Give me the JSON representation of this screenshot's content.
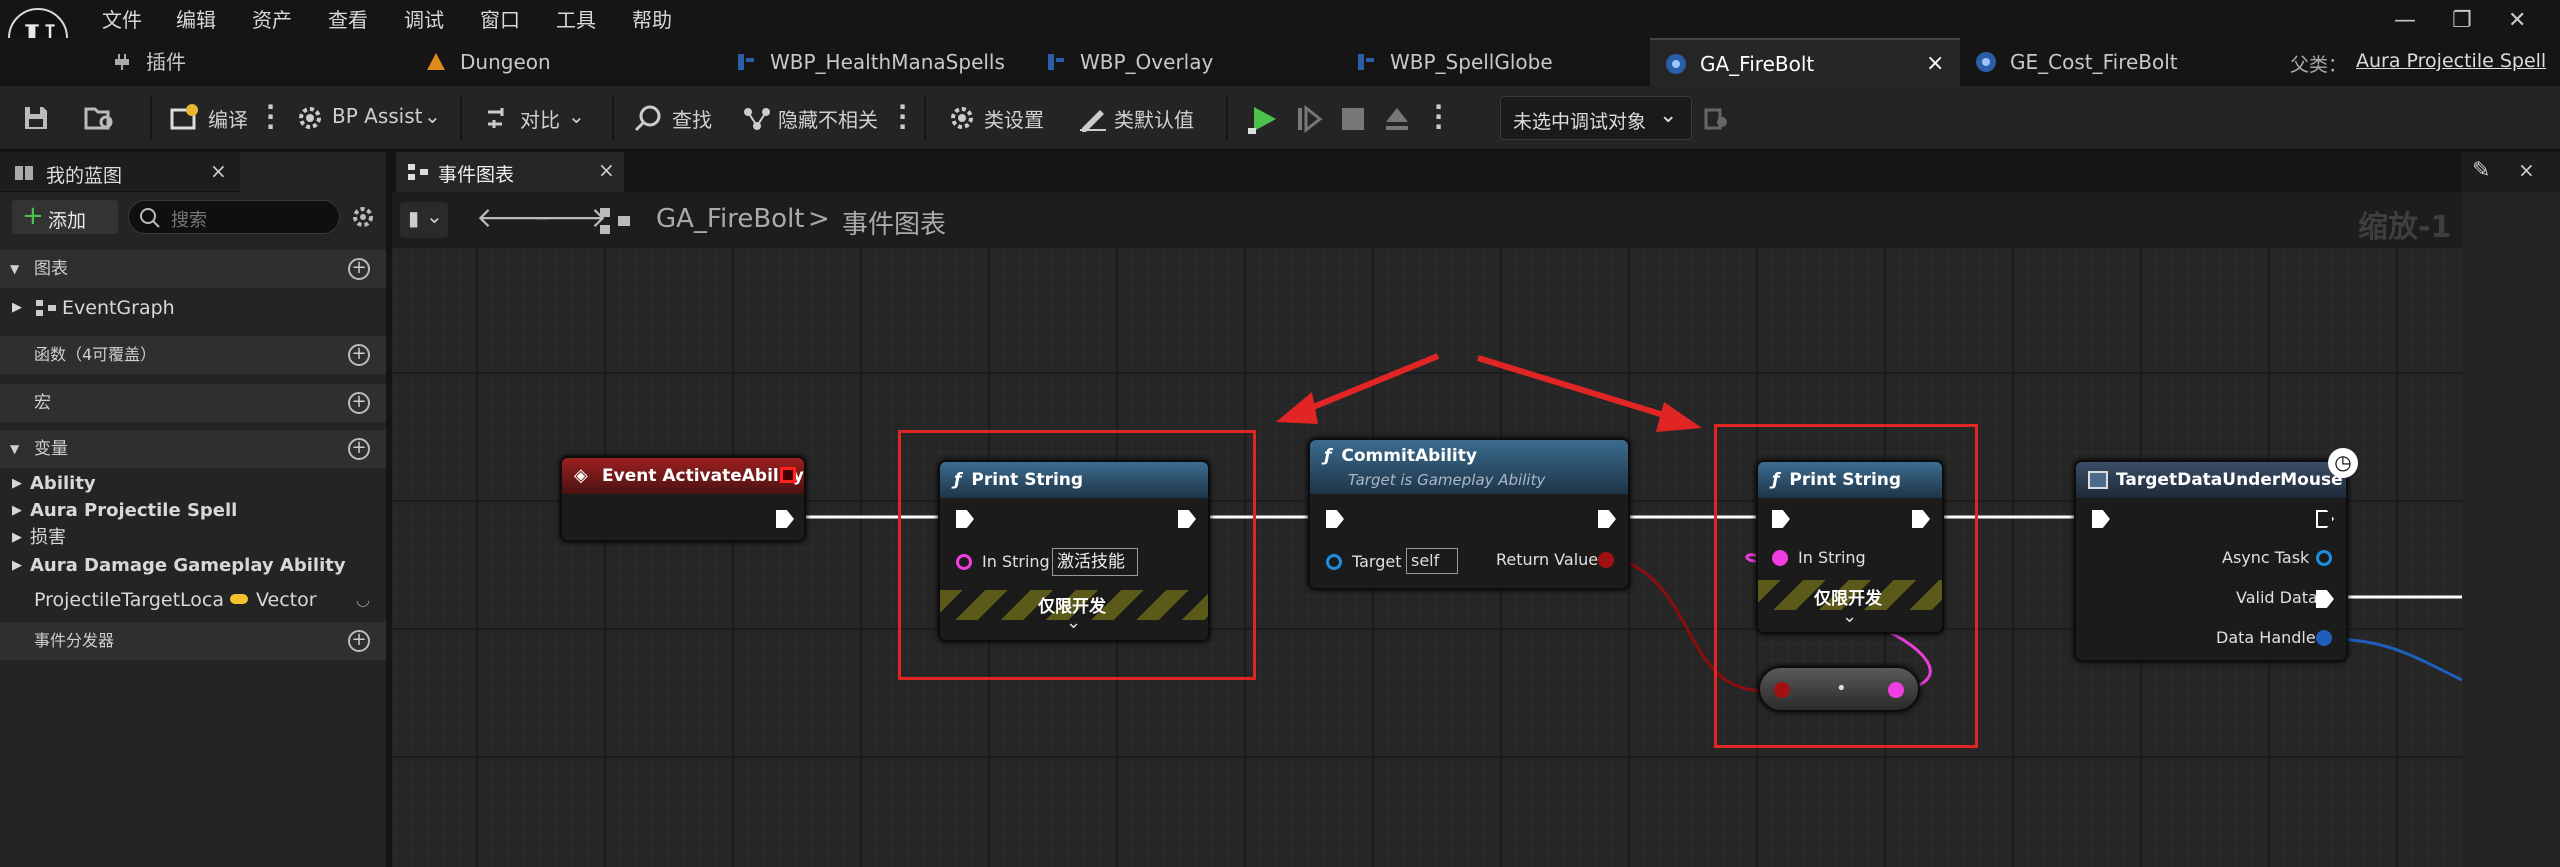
{
  "menu": {
    "file": "文件",
    "edit": "编辑",
    "asset": "资产",
    "view": "查看",
    "debug": "调试",
    "window": "窗口",
    "tools": "工具",
    "help": "帮助"
  },
  "tabs": {
    "plugins": "插件",
    "dungeon": "Dungeon",
    "wbp_health": "WBP_HealthManaSpells",
    "wbp_overlay": "WBP_Overlay",
    "wbp_spellglobe": "WBP_SpellGlobe",
    "ga_firebolt": "GA_FireBolt",
    "ge_cost": "GE_Cost_FireBolt",
    "close": "×",
    "parent_label": "父类：",
    "parent_value": "Aura Projectile Spell"
  },
  "toolbar": {
    "compile": "编译",
    "bp_assist": "BP Assist",
    "diff": "对比",
    "find": "查找",
    "hide_unrelated": "隐藏不相关",
    "class_settings": "类设置",
    "class_defaults": "类默认值",
    "debug_target": "未选中调试对象"
  },
  "left": {
    "title": "我的蓝图",
    "add": "添加",
    "search_placeholder": "搜索",
    "sec_graph": "图表",
    "eventgraph": "EventGraph",
    "sec_functions": "函数（4可覆盖）",
    "sec_macros": "宏",
    "sec_variables": "变量",
    "var_ability": "Ability",
    "var_aura_proj": "Aura Projectile Spell",
    "var_damage": "损害",
    "var_aura_damage": "Aura Damage Gameplay Ability",
    "var_target_name": "ProjectileTargetLoca",
    "var_target_type": "Vector",
    "sec_dispatchers": "事件分发器"
  },
  "graph": {
    "tab": "事件图表",
    "breadcrumb_asset": "GA_FireBolt",
    "breadcrumb_sep": ">",
    "breadcrumb_graph": "事件图表",
    "zoom": "缩放-1"
  },
  "nodes": {
    "event": {
      "title": "Event ActivateAbility"
    },
    "print1": {
      "title": "Print String",
      "in_label": "In String",
      "in_value": "激活技能",
      "dev": "仅限开发"
    },
    "commit": {
      "title": "CommitAbility",
      "subtitle": "Target is Gameplay Ability",
      "target_label": "Target",
      "target_value": "self",
      "return_label": "Return Value"
    },
    "print2": {
      "title": "Print String",
      "in_label": "In String",
      "dev": "仅限开发"
    },
    "conv": {
      "dot": "•"
    },
    "target_data": {
      "title": "TargetDataUnderMouse",
      "async": "Async Task",
      "valid": "Valid Data",
      "handle": "Data Handle"
    }
  },
  "colors": {
    "accent": "#4a8fe0",
    "event_header": "#8a1c1c",
    "func_header": "#2f5a7a",
    "string_pin": "#f03ce0",
    "bool_pin": "#a31010",
    "object_pin": "#1e8fe0",
    "vector_pin": "#f6c12e",
    "play_green": "#4cc24c",
    "annotation_red": "#e12525"
  }
}
